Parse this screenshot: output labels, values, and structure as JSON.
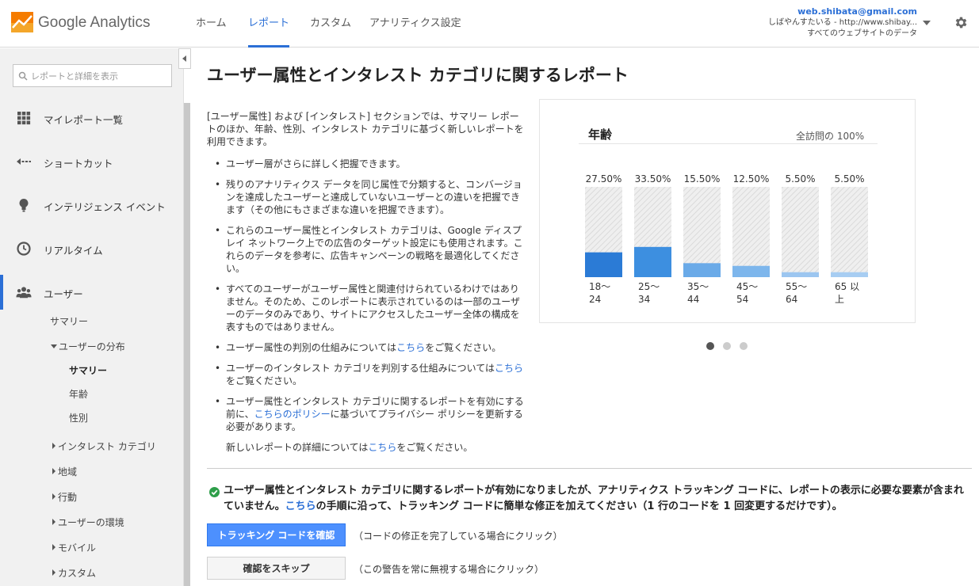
{
  "app": {
    "brand_name": "Google Analytics",
    "logo_icon": "analytics-logo-icon"
  },
  "nav": {
    "tabs": [
      "ホーム",
      "レポート",
      "カスタム",
      "アナリティクス設定"
    ],
    "active": "レポート"
  },
  "account": {
    "email": "web.shibata@gmail.com",
    "property": "しばやんすたいる - http://www.shibay...",
    "view": "すべてのウェブサイトのデータ"
  },
  "sidebar": {
    "search_placeholder": "レポートと詳細を表示",
    "items": [
      {
        "label": "マイレポート一覧",
        "icon": "grid-icon"
      },
      {
        "label": "ショートカット",
        "icon": "shortcut-arrow-icon"
      },
      {
        "label": "インテリジェンス イベント",
        "icon": "lightbulb-icon"
      },
      {
        "label": "リアルタイム",
        "icon": "clock-icon"
      },
      {
        "label": "ユーザー",
        "icon": "users-icon"
      }
    ],
    "sub": {
      "summary": "サマリー",
      "distribution": "ユーザーの分布",
      "dist_summary": "サマリー",
      "age": "年齢",
      "gender": "性別",
      "interests": "インタレスト カテゴリ",
      "geo": "地域",
      "behavior": "行動",
      "technology": "ユーザーの環境",
      "mobile": "モバイル",
      "custom": "カスタム"
    }
  },
  "main": {
    "title": "ユーザー属性とインタレスト カテゴリに関するレポート",
    "intro": "[ユーザー属性] および [インタレスト] セクションでは、サマリー レポートのほか、年齢、性別、インタレスト カテゴリに基づく新しいレポートを利用できます。",
    "bullets": {
      "b1": "ユーザー層がさらに詳しく把握できます。",
      "b2": "残りのアナリティクス データを同じ属性で分類すると、コンバージョンを達成したユーザーと達成していないユーザーとの違いを把握できます（その他にもさまざまな違いを把握できます）。",
      "b3": "これらのユーザー属性とインタレスト カテゴリは、Google ディスプレイ ネットワーク上での広告のターゲット設定にも使用されます。これらのデータを参考に、広告キャンペーンの戦略を最適化してください。",
      "b4": "すべてのユーザーがユーザー属性と関連付けられているわけではありません。そのため、このレポートに表示されているのは一部のユーザーのデータのみであり、サイトにアクセスしたユーザー全体の構成を表すものではありません。",
      "b5_pre": "ユーザー属性の判別の仕組みについては",
      "b5_link": "こちら",
      "b5_post": "をご覧ください。",
      "b6_pre": "ユーザーのインタレスト カテゴリを判別する仕組みについては",
      "b6_link": "こちら",
      "b6_post": "をご覧ください。",
      "b7_pre": "ユーザー属性とインタレスト カテゴリに関するレポートを有効にする前に、",
      "b7_link": "こちらのポリシー",
      "b7_post": "に基づいてプライバシー ポリシーを更新する必要があります。",
      "b8_pre": "新しいレポートの詳細については",
      "b8_link": "こちら",
      "b8_post": "をご覧ください。"
    },
    "notice": {
      "pre": "ユーザー属性とインタレスト カテゴリに関するレポートが有効になりましたが、アナリティクス トラッキング コードに、レポートの表示に必要な要素が含まれていません。",
      "link": "こちら",
      "post": "の手順に沿って、トラッキング コードに簡単な修正を加えてください（1 行のコードを 1 回変更するだけです）。"
    },
    "buttons": {
      "confirm": "トラッキング コードを確認",
      "confirm_note": "（コードの修正を完了している場合にクリック）",
      "skip": "確認をスキップ",
      "skip_note": "（この警告を常に無視する場合にクリック）"
    },
    "carousel": {
      "count": 3,
      "active": 0
    }
  },
  "chart_data": {
    "type": "bar",
    "title": "年齢",
    "total_label": "全訪問の 100%",
    "categories": [
      "18〜24",
      "25〜34",
      "35〜44",
      "45〜54",
      "55〜64",
      "65 以上"
    ],
    "category_lines": [
      [
        "18〜",
        "24"
      ],
      [
        "25〜",
        "34"
      ],
      [
        "35〜",
        "44"
      ],
      [
        "45〜",
        "54"
      ],
      [
        "55〜",
        "64"
      ],
      [
        "65 以",
        "上"
      ]
    ],
    "values": [
      27.5,
      33.5,
      15.5,
      12.5,
      5.5,
      5.5
    ],
    "value_labels": [
      "27.50%",
      "33.50%",
      "15.50%",
      "12.50%",
      "5.50%",
      "5.50%"
    ],
    "ylim": [
      0,
      100
    ],
    "colors": [
      "#2b7bd6",
      "#3d8fe0",
      "#6aaae8",
      "#7db6ec",
      "#9cc6f0",
      "#a7cdf2"
    ]
  },
  "colors": {
    "accent": "#2b6fd6",
    "button": "#4d90fe",
    "check": "#2e9e4a"
  }
}
